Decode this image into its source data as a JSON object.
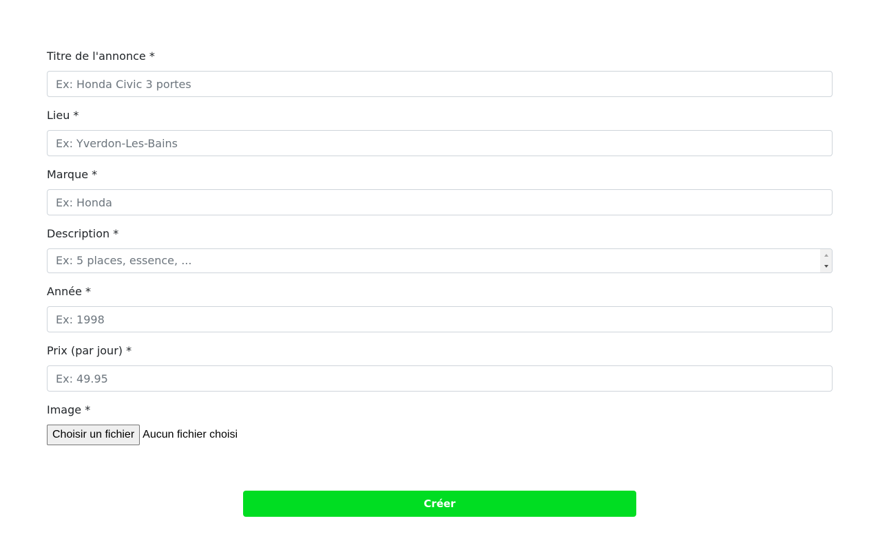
{
  "form": {
    "title": {
      "label": "Titre de l'annonce *",
      "placeholder": "Ex: Honda Civic 3 portes",
      "value": ""
    },
    "location": {
      "label": "Lieu *",
      "placeholder": "Ex: Yverdon-Les-Bains",
      "value": ""
    },
    "brand": {
      "label": "Marque *",
      "placeholder": "Ex: Honda",
      "value": ""
    },
    "description": {
      "label": "Description *",
      "placeholder": "Ex: 5 places, essence, ...",
      "value": ""
    },
    "year": {
      "label": "Année *",
      "placeholder": "Ex: 1998",
      "value": ""
    },
    "price": {
      "label": "Prix (par jour) *",
      "placeholder": "Ex: 49.95",
      "value": ""
    },
    "image": {
      "label": "Image *",
      "button_label": "Choisir un fichier",
      "status_text": "Aucun fichier choisi"
    },
    "submit_label": "Créer"
  },
  "colors": {
    "submit_background": "#00dd22",
    "submit_text": "#ffffff",
    "input_border": "#ced4da",
    "placeholder": "#6c757d"
  }
}
